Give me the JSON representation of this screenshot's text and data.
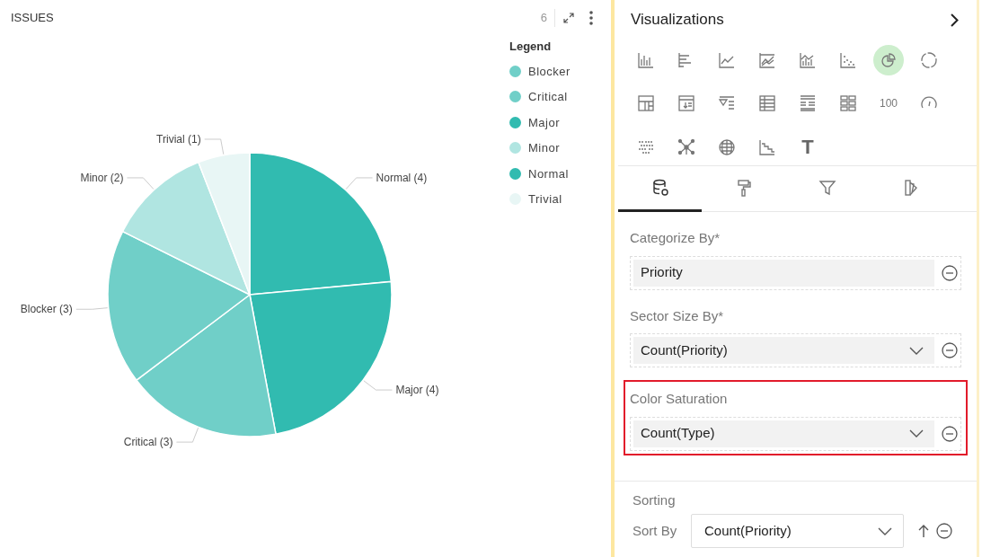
{
  "panel": {
    "title": "ISSUES",
    "count": "6"
  },
  "chart": {
    "chart_data": {
      "type": "pie",
      "values": [
        4,
        4,
        3,
        3,
        2,
        1
      ],
      "colors": [
        "#31bbb0",
        "#31bbb0",
        "#70cfc8",
        "#70cfc8",
        "#b0e5e1",
        "#e8f6f5"
      ],
      "value_labels": [
        "Normal (4)",
        "Major (4)",
        "Critical (3)",
        "Blocker (3)",
        "Minor (2)",
        "Trivial (1)"
      ]
    }
  },
  "legend": {
    "title": "Legend",
    "items": [
      {
        "label": "Blocker",
        "color": "#70cfc8"
      },
      {
        "label": "Critical",
        "color": "#70cfc8"
      },
      {
        "label": "Major",
        "color": "#31bbb0"
      },
      {
        "label": "Minor",
        "color": "#b0e5e1"
      },
      {
        "label": "Normal",
        "color": "#31bbb0"
      },
      {
        "label": "Trivial",
        "color": "#e8f6f5"
      }
    ]
  },
  "visualizations": {
    "title": "Visualizations",
    "items": [
      {
        "kind": "icon",
        "selected": false
      },
      {
        "kind": "icon",
        "selected": false
      },
      {
        "kind": "icon",
        "selected": false
      },
      {
        "kind": "icon",
        "selected": false
      },
      {
        "kind": "icon",
        "selected": false
      },
      {
        "kind": "icon",
        "selected": false
      },
      {
        "kind": "icon",
        "selected": true
      },
      {
        "kind": "icon",
        "selected": false
      },
      {
        "kind": "icon",
        "selected": false
      },
      {
        "kind": "icon",
        "selected": false
      },
      {
        "kind": "icon",
        "selected": false
      },
      {
        "kind": "icon",
        "selected": false
      },
      {
        "kind": "icon",
        "selected": false
      },
      {
        "kind": "icon",
        "selected": false
      },
      {
        "kind": "text",
        "text": "100",
        "selected": false
      },
      {
        "kind": "icon",
        "selected": false
      },
      {
        "kind": "icon",
        "selected": false
      },
      {
        "kind": "icon",
        "selected": false
      },
      {
        "kind": "icon",
        "selected": false
      },
      {
        "kind": "icon",
        "selected": false
      },
      {
        "kind": "bold",
        "text": "T",
        "selected": false
      }
    ]
  },
  "config_tabs": [
    {
      "selected": true
    },
    {
      "selected": false
    },
    {
      "selected": false
    },
    {
      "selected": false
    }
  ],
  "fields": [
    {
      "label": "Categorize By*",
      "value": "Priority",
      "dropdown": false,
      "highlighted": false
    },
    {
      "label": "Sector Size By*",
      "value": "Count(Priority)",
      "dropdown": true,
      "highlighted": false
    },
    {
      "label": "Color Saturation",
      "value": "Count(Type)",
      "dropdown": true,
      "highlighted": true
    }
  ],
  "sorting": {
    "title": "Sorting",
    "label": "Sort By",
    "value": "Count(Priority)"
  }
}
